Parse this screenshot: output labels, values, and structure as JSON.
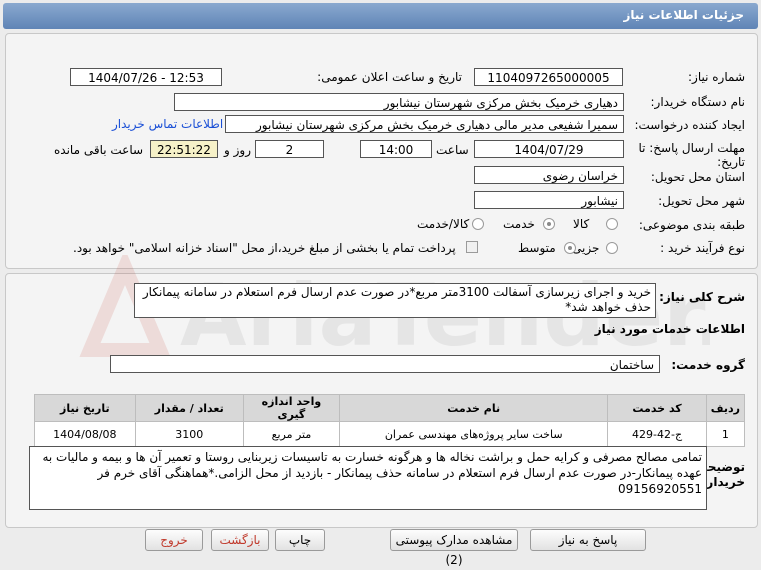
{
  "title": "جزئیات اطلاعات نیاز",
  "labels": {
    "need_number": "شماره نیاز:",
    "announce_datetime": "تاریخ و ساعت اعلان عمومی:",
    "buyer_org": "نام دستگاه خریدار:",
    "request_creator": "ایجاد کننده درخواست:",
    "contact_link": "اطلاعات تماس خریدار",
    "deadline": "مهلت ارسال پاسخ: تا تاریخ:",
    "time_word": "ساعت",
    "days_and": "روز و",
    "remaining": "ساعت باقی مانده",
    "province": "استان محل تحویل:",
    "city": "شهر محل تحویل:",
    "category": "طبقه بندی موضوعی:",
    "process_type": "نوع فرآیند خرید :",
    "description": "شرح کلی نیاز:",
    "services_info": "اطلاعات خدمات مورد نیاز",
    "service_group": "گروه خدمت:",
    "buyer_notes": "توضیحات خریدار:"
  },
  "fields": {
    "need_number": "1104097265000005",
    "announce_datetime": "1404/07/26 - 12:53",
    "buyer_org": "دهیاری خرمیک بخش مرکزی شهرستان نیشابور",
    "request_creator": "سمیرا شفیعی مدیر مالی دهیاری خرمیک بخش مرکزی شهرستان نیشابور",
    "deadline_date": "1404/07/29",
    "deadline_time": "14:00",
    "days": "2",
    "remaining_time": "22:51:22",
    "province": "خراسان رضوی",
    "city": "نیشابور",
    "description": "خرید و اجرای زیرسازی آسفالت 3100متر مربع*در صورت عدم ارسال فرم استعلام در سامانه پیمانکار حذف خواهد شد*",
    "service_group": "ساختمان",
    "buyer_notes": "تمامی مصالح مصرفی و کرایه حمل و براشت نخاله ها و هرگونه خسارت به تاسیسات زیربنایی روستا و تعمیر آن ها و بیمه و مالیات به عهده پیمانکار-در صورت عدم ارسال فرم استعلام در سامانه حذف پیمانکار - بازدید از محل الزامی.*هماهنگی آقای خرم فر 09156920551"
  },
  "category_options": [
    "کالا",
    "خدمت",
    "کالا/خدمت"
  ],
  "category_selected": "خدمت",
  "process_options": [
    "جزیی",
    "متوسط"
  ],
  "process_selected": "متوسط",
  "payment_note": "پرداخت تمام یا بخشی از مبلغ خرید،از محل \"اسناد خزانه اسلامی\" خواهد بود.",
  "table": {
    "headers": [
      "ردیف",
      "کد خدمت",
      "نام خدمت",
      "واحد اندازه گیری",
      "تعداد / مقدار",
      "تاریخ نیاز"
    ],
    "rows": [
      [
        "1",
        "ج-42-429",
        "ساخت سایر پروژه‌های مهندسی عمران",
        "متر مربع",
        "3100",
        "1404/08/08"
      ]
    ]
  },
  "buttons": {
    "reply": "پاسخ به نیاز",
    "view_docs": "مشاهده مدارک پیوستی (2)",
    "print": "چاپ",
    "back": "بازگشت",
    "exit": "خروج"
  },
  "watermark": "AriaTender.net",
  "colors": {
    "titlebar": "#6f92c0",
    "link": "#1a4fd6",
    "remaining_bg": "#f6f1c8",
    "back_exit_text": "#c0392b"
  }
}
